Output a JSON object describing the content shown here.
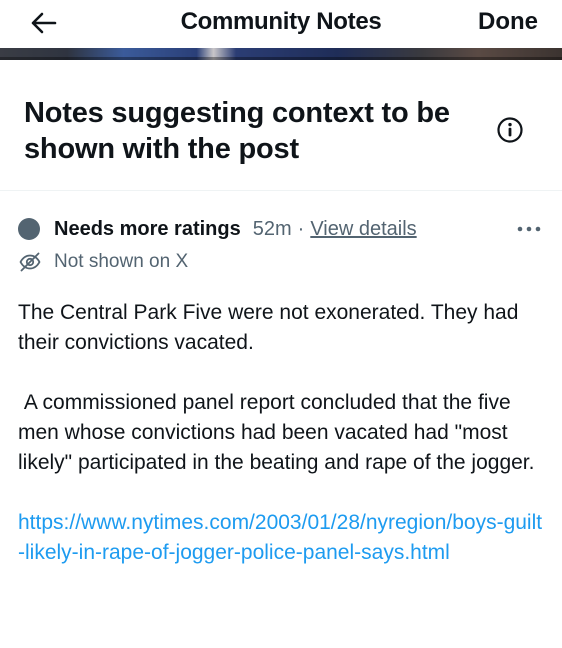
{
  "header": {
    "title": "Community Notes",
    "done_label": "Done",
    "back_icon": "arrow-left-icon"
  },
  "section": {
    "title": "Notes suggesting context to be shown with the post",
    "info_icon": "info-icon"
  },
  "note": {
    "status": "Needs more ratings",
    "time": "52m",
    "separator": "·",
    "view_details_label": "View details",
    "visibility": "Not shown on X",
    "visibility_icon": "eye-off-icon",
    "more_icon": "more-options-icon",
    "paragraph1": "The Central Park Five were not exonerated. They had their convictions vacated.",
    "paragraph2": " A commissioned panel report concluded that the five men whose convictions had been vacated had \"most likely\" participated in the beating and rape of the jogger.",
    "link": "https://www.nytimes.com/2003/01/28/nyregion/boys-guilt-likely-in-rape-of-jogger-police-panel-says.html"
  },
  "colors": {
    "text_primary": "#0f1419",
    "text_secondary": "#536471",
    "link": "#1d9bf0",
    "status_dot": "#536471",
    "divider": "#eff3f4"
  }
}
